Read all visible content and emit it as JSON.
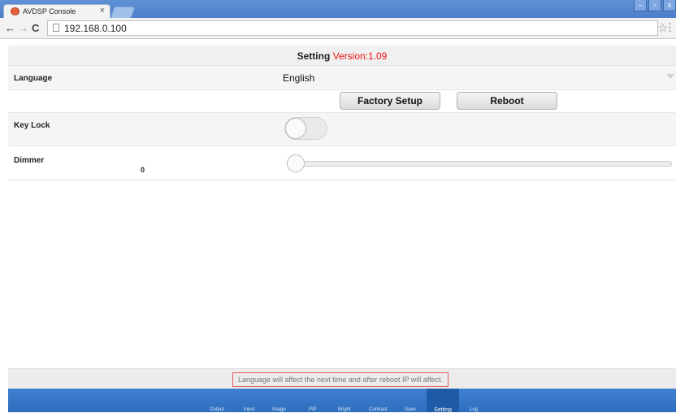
{
  "browser": {
    "tab_title": "AVDSP Console",
    "tab_close": "×",
    "url": "192.168.0.100",
    "window_buttons": [
      "–",
      "▫",
      "x"
    ]
  },
  "header": {
    "title": "Setting",
    "version": "Version:1.09"
  },
  "language": {
    "label": "Language",
    "value": "English"
  },
  "buttons": {
    "factory_setup": "Factory Setup",
    "reboot": "Reboot"
  },
  "key_lock": {
    "label": "Key Lock",
    "on": false
  },
  "dimmer": {
    "label": "Dimmer",
    "value": "0"
  },
  "note": "Language will affect the next time and after reboot IP will affect.",
  "bottom_nav": {
    "items": [
      "Output",
      "Input",
      "Image",
      "PIP",
      "Bright",
      "Contrast",
      "Save",
      "Setting",
      "Log"
    ],
    "active": "Setting"
  },
  "colors": {
    "version": "#ee1111",
    "nav_bar": "#3f7fd0",
    "note_border": "#e35a5a"
  }
}
